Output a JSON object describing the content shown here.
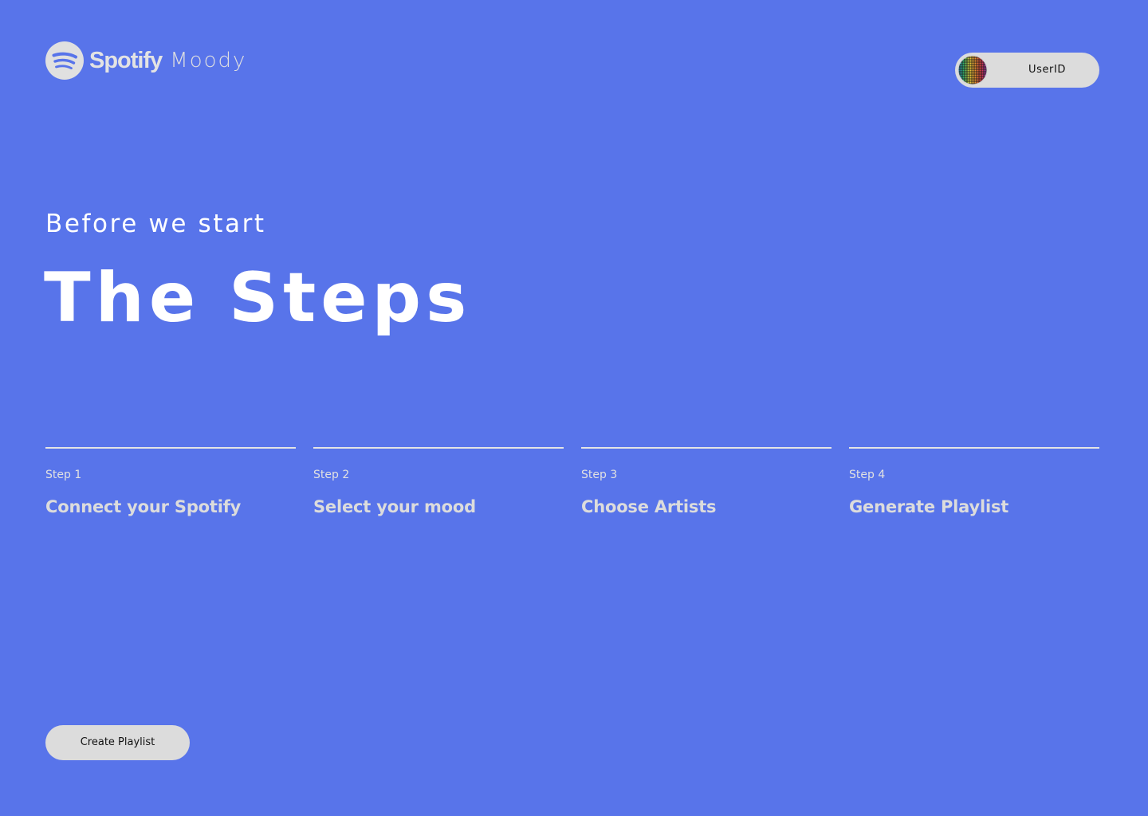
{
  "header": {
    "brand": "Spotify",
    "brand_suffix": "Moody",
    "logo_icon": "spotify-logo-icon"
  },
  "user": {
    "label": "UserID",
    "avatar_icon": "user-avatar-icon"
  },
  "hero": {
    "eyebrow": "Before we start",
    "title": "The Steps"
  },
  "steps": [
    {
      "number": "Step 1",
      "title": "Connect your Spotify"
    },
    {
      "number": "Step 2",
      "title": "Select your mood"
    },
    {
      "number": "Step 3",
      "title": "Choose Artists"
    },
    {
      "number": "Step 4",
      "title": "Generate Playlist"
    }
  ],
  "cta": {
    "label": "Create Playlist"
  },
  "colors": {
    "background": "#5874ea",
    "pill": "#dcdcdc",
    "rule": "#e4e4e4",
    "text_primary": "#ffffff",
    "text_muted": "#dcdcdc",
    "pill_text": "#111111"
  }
}
